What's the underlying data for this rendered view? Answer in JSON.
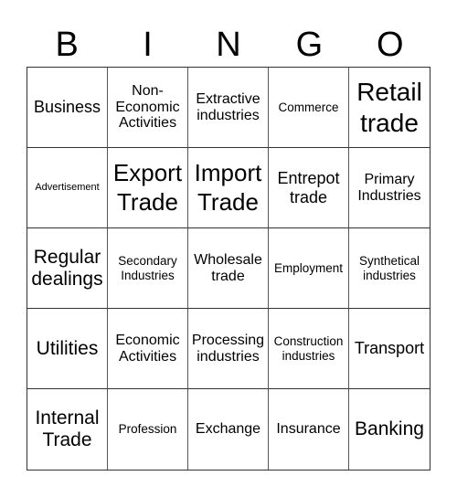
{
  "header": {
    "letters": [
      "B",
      "I",
      "N",
      "G",
      "O"
    ]
  },
  "cells": [
    {
      "text": "Business",
      "size": "fs-ml"
    },
    {
      "text": "Non-\nEconomic\nActivities",
      "size": "fs-m"
    },
    {
      "text": "Extractive\nindustries",
      "size": "fs-m"
    },
    {
      "text": "Commerce",
      "size": "fs-s"
    },
    {
      "text": "Retail\ntrade",
      "size": "fs-xxl"
    },
    {
      "text": "Advertisement",
      "size": "fs-xs"
    },
    {
      "text": "Export\nTrade",
      "size": "fs-xl"
    },
    {
      "text": "Import\nTrade",
      "size": "fs-xl"
    },
    {
      "text": "Entrepot\ntrade",
      "size": "fs-ml"
    },
    {
      "text": "Primary\nIndustries",
      "size": "fs-m"
    },
    {
      "text": "Regular\ndealings",
      "size": "fs-l"
    },
    {
      "text": "Secondary\nIndustries",
      "size": "fs-s"
    },
    {
      "text": "Wholesale\ntrade",
      "size": "fs-m"
    },
    {
      "text": "Employment",
      "size": "fs-s"
    },
    {
      "text": "Synthetical\nindustries",
      "size": "fs-s"
    },
    {
      "text": "Utilities",
      "size": "fs-l"
    },
    {
      "text": "Economic\nActivities",
      "size": "fs-m"
    },
    {
      "text": "Processing\nindustries",
      "size": "fs-m"
    },
    {
      "text": "Construction\nindustries",
      "size": "fs-s"
    },
    {
      "text": "Transport",
      "size": "fs-ml"
    },
    {
      "text": "Internal\nTrade",
      "size": "fs-l"
    },
    {
      "text": "Profession",
      "size": "fs-s"
    },
    {
      "text": "Exchange",
      "size": "fs-m"
    },
    {
      "text": "Insurance",
      "size": "fs-m"
    },
    {
      "text": "Banking",
      "size": "fs-l"
    }
  ]
}
